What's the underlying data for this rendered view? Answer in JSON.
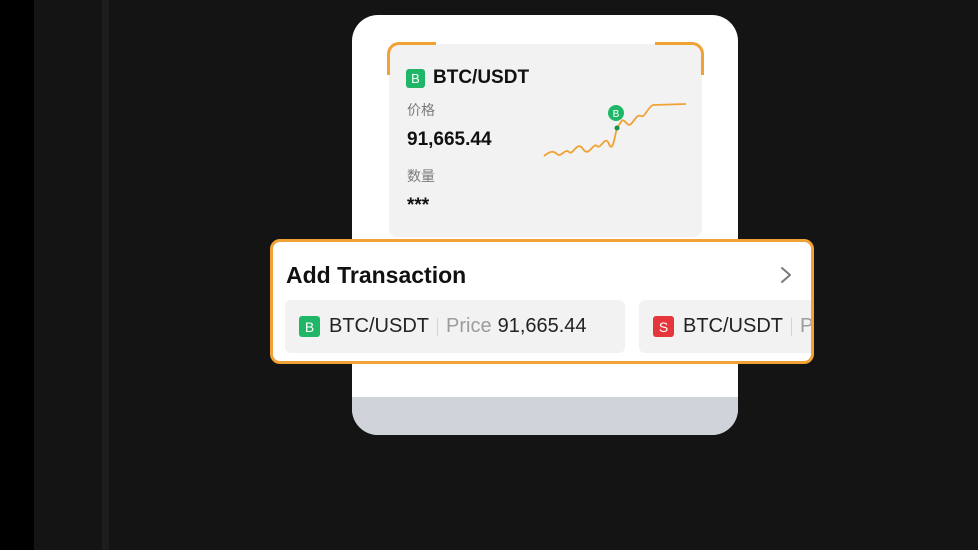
{
  "trade_card": {
    "pair": "BTC/USDT",
    "side_badge": "B",
    "price_label": "价格",
    "price_value": "91,665.44",
    "quantity_label": "数量",
    "quantity_value": "***",
    "chart_marker": "B"
  },
  "add_transaction": {
    "title": "Add Transaction",
    "items": [
      {
        "side": "B",
        "pair": "BTC/USDT",
        "price_label": "Price",
        "price_value": "91,665.44"
      },
      {
        "side": "S",
        "pair": "BTC/USDT",
        "price_label": "P",
        "price_value": ""
      }
    ]
  },
  "colors": {
    "accent": "#f0a234",
    "buy": "#1fb767",
    "sell": "#e5363c",
    "background": "#141414"
  },
  "icons": {
    "chevron": "chevron-right-icon",
    "side": "side-badge-icon"
  }
}
